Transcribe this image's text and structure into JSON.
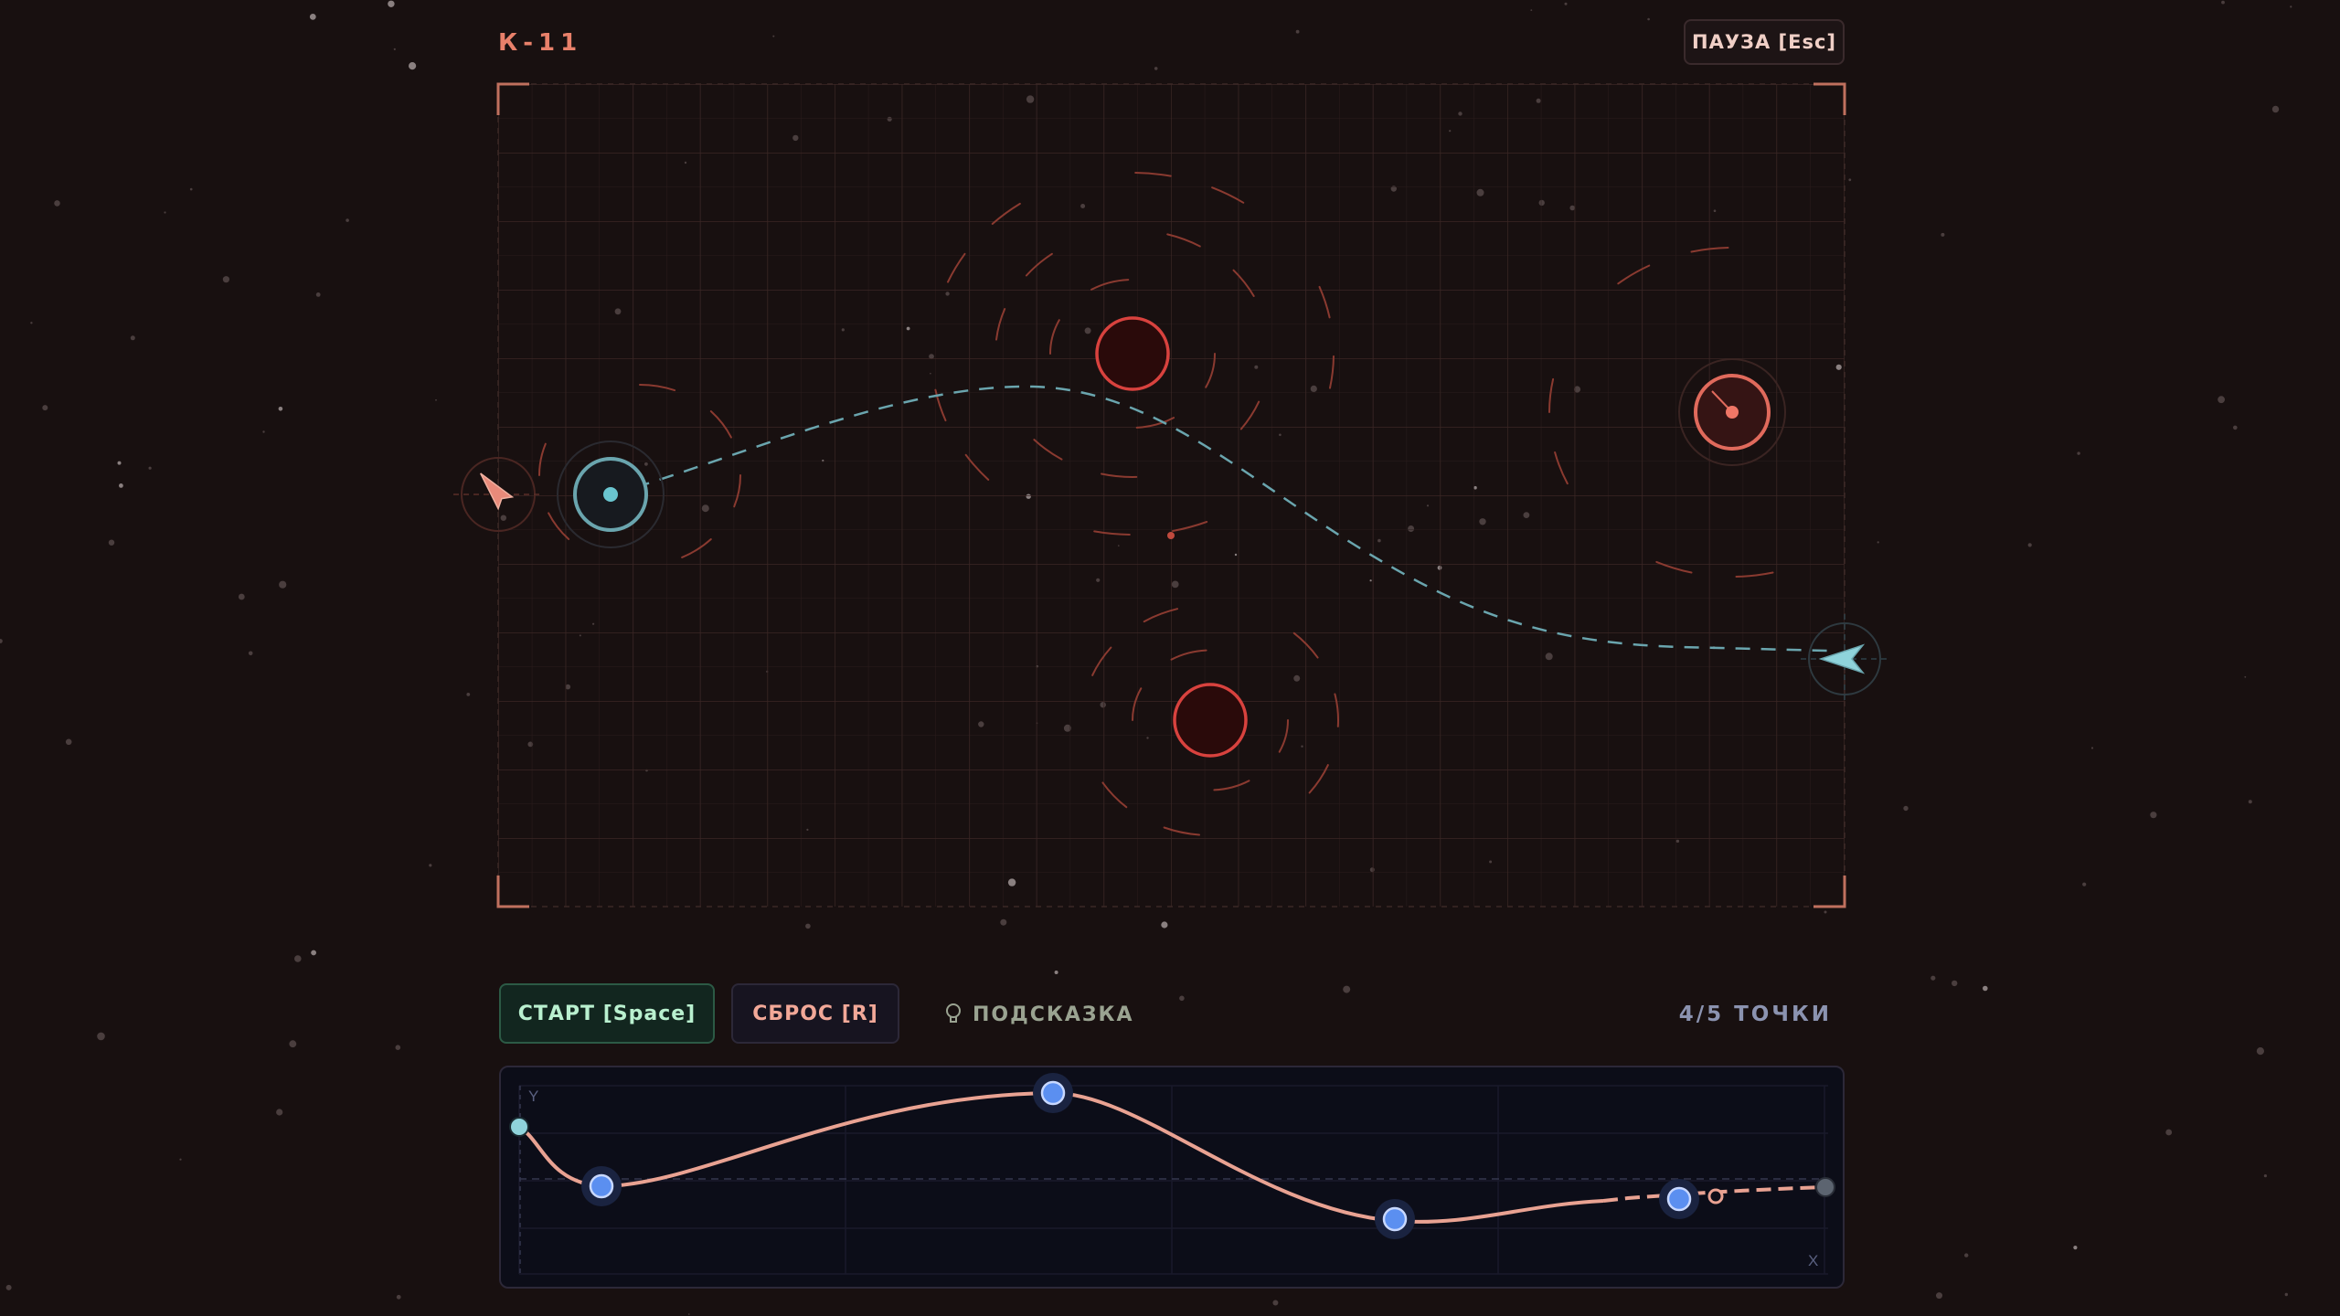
{
  "level": {
    "title": "К-11"
  },
  "pause_button": {
    "label": "ПАУЗА [Esc]"
  },
  "controls": {
    "start_label": "СТАРТ [Space]",
    "reset_label": "СБРОС [R]",
    "hint_label": "ПОДСКАЗКА",
    "points_label": "4/5 ТОЧКИ"
  },
  "graph": {
    "y_axis_label": "Y",
    "x_axis_label": "X"
  },
  "icons": {
    "player_ship": "rocket-ship-icon",
    "target_ship": "arrow-ship-icon",
    "hint": "lightbulb-icon"
  },
  "colors": {
    "accent_red": "#e8806a",
    "planet_red": "#d8423e",
    "path_teal": "#6aa5ae",
    "graph_curve": "#e9a292",
    "control_point": "#5b8ff0",
    "start_green": "#b9f0cf"
  }
}
